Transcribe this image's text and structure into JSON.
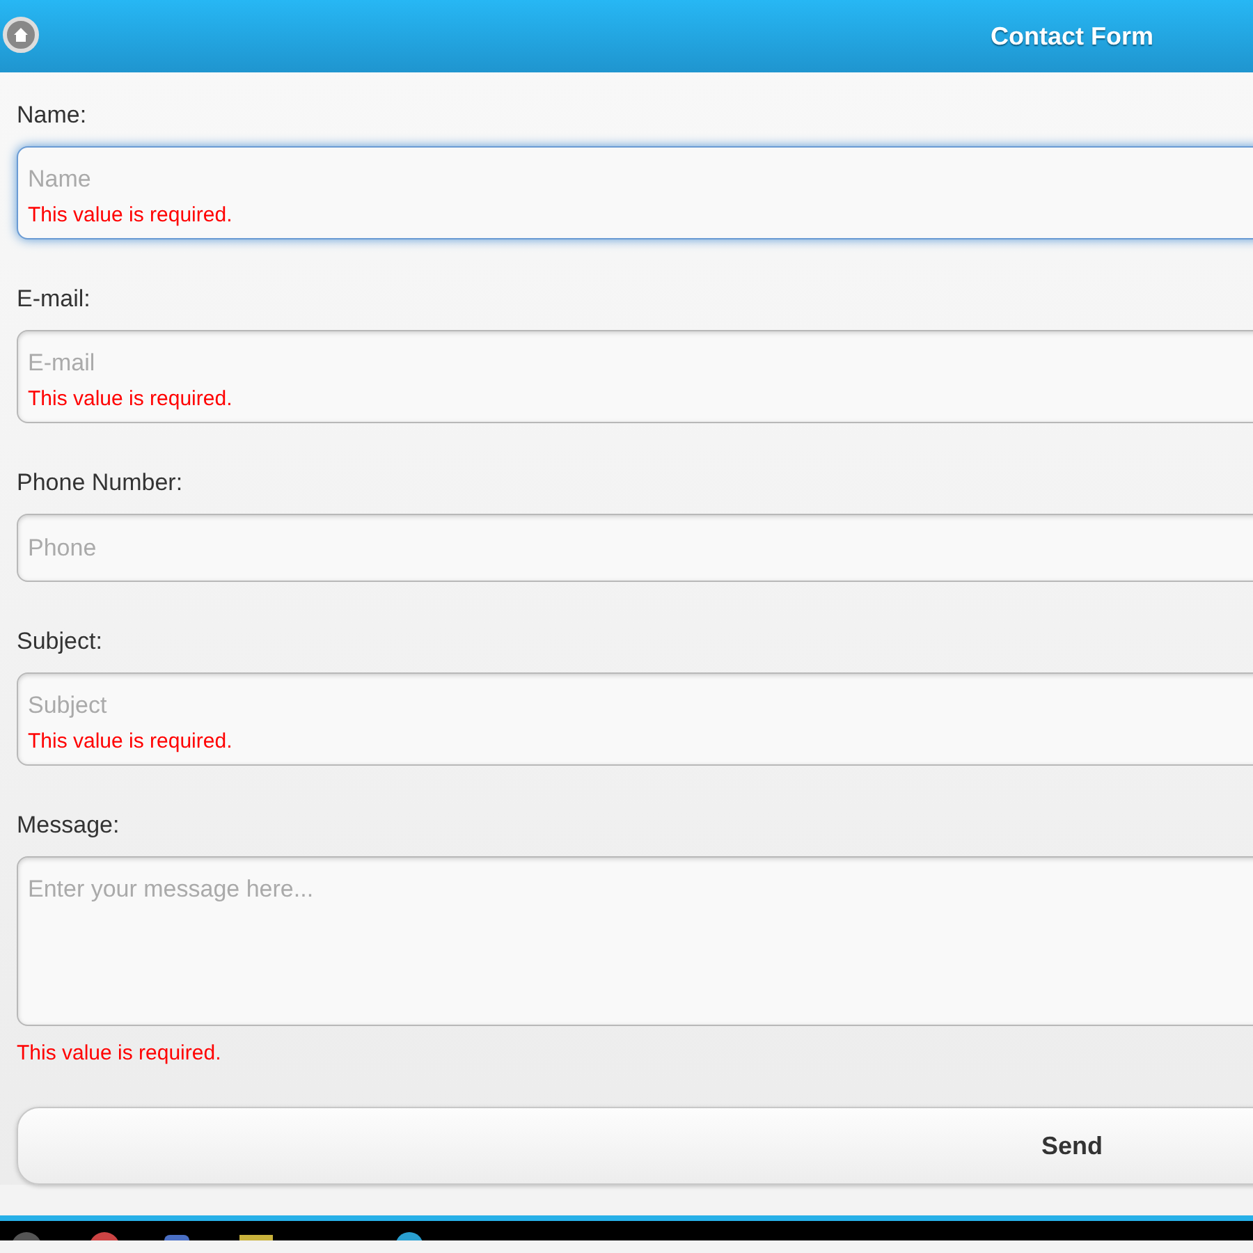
{
  "header": {
    "title": "Contact Form"
  },
  "fields": [
    {
      "kind": "input",
      "label": "Name:",
      "placeholder": "Name",
      "focused": true,
      "error": "This value is required."
    },
    {
      "kind": "input",
      "label": "E-mail:",
      "placeholder": "E-mail",
      "focused": false,
      "error": "This value is required."
    },
    {
      "kind": "input",
      "label": "Phone Number:",
      "placeholder": "Phone",
      "focused": false
    },
    {
      "kind": "input",
      "label": "Subject:",
      "placeholder": "Subject",
      "focused": false,
      "error": "This value is required."
    },
    {
      "kind": "textarea",
      "label": "Message:",
      "placeholder": "Enter your message here...",
      "focused": false,
      "error": "This value is required."
    }
  ],
  "send_button": "Send"
}
